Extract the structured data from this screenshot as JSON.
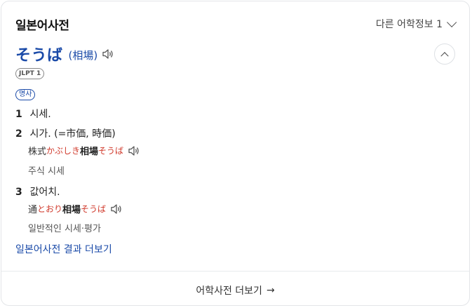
{
  "header": {
    "title": "일본어사전",
    "more_info": "다른 어학정보 1"
  },
  "entry": {
    "headword": "そうば",
    "kanji": "(相場)",
    "jlpt": "JLPT 1",
    "pos": "명사"
  },
  "senses": [
    {
      "num": "1",
      "meaning": "시세."
    },
    {
      "num": "2",
      "meaning": "시가. (=市価, 時価)",
      "example": {
        "pre": "株式",
        "pre_reading": "かぶしき",
        "word": "相場",
        "word_reading": "そうば"
      },
      "translation": "주식 시세"
    },
    {
      "num": "3",
      "meaning": "값어치.",
      "example": {
        "pre": "通",
        "pre_reading": "とおり",
        "word": "相場",
        "word_reading": "そうば"
      },
      "translation": "일반적인 시세·평가"
    }
  ],
  "more_results": "일본어사전 결과 더보기",
  "footer": {
    "label": "어학사전 더보기",
    "arrow": "→"
  },
  "icons": {
    "speaker": "speaker-icon",
    "collapse": "chevron-up-icon",
    "dropdown": "chevron-down-icon"
  }
}
